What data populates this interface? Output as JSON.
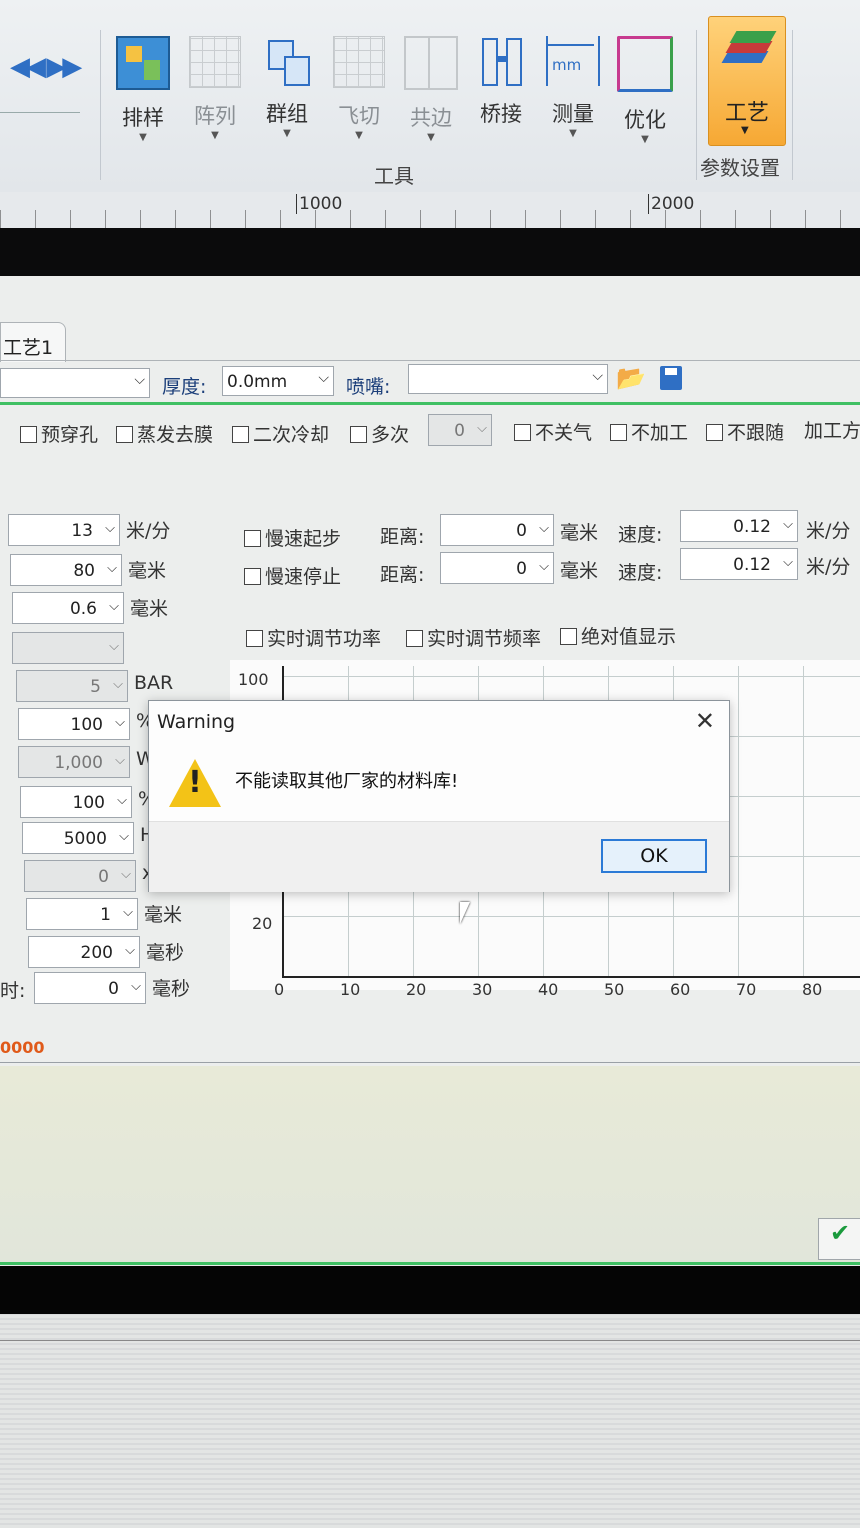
{
  "ribbon": {
    "tools": [
      {
        "label": "排样",
        "icon": "nesting-icon"
      },
      {
        "label": "阵列",
        "icon": "array-icon"
      },
      {
        "label": "群组",
        "icon": "group-icon"
      },
      {
        "label": "飞切",
        "icon": "fly-cut-icon"
      },
      {
        "label": "共边",
        "icon": "common-edge-icon"
      },
      {
        "label": "桥接",
        "icon": "bridge-icon"
      },
      {
        "label": "测量",
        "icon": "measure-icon"
      },
      {
        "label": "优化",
        "icon": "optimize-icon"
      }
    ],
    "group_label": "工具",
    "craft_label": "工艺",
    "param_group_label": "参数设置",
    "measure_unit": "mm"
  },
  "ruler": {
    "marks": [
      "1000",
      "2000"
    ]
  },
  "panel": {
    "tab_label": "工艺1",
    "thickness_label": "厚度:",
    "thickness_value": "0.0mm",
    "nozzle_label": "喷嘴:",
    "nozzle_value": "",
    "options": [
      "预穿孔",
      "蒸发去膜",
      "二次冷却",
      "多次"
    ],
    "multi_count": "0",
    "options_right": [
      "不关气",
      "不加工",
      "不跟随",
      "加工方"
    ],
    "left_params": [
      {
        "value": "13",
        "unit": "米/分"
      },
      {
        "value": "80",
        "unit": "毫米"
      },
      {
        "value": "0.6",
        "unit": "毫米"
      },
      {
        "value": "",
        "unit": ""
      },
      {
        "value": "5",
        "unit": "BAR"
      },
      {
        "value": "100",
        "unit": "%"
      },
      {
        "value": "1,000",
        "unit": "W"
      },
      {
        "value": "100",
        "unit": "%"
      },
      {
        "value": "5000",
        "unit": "H"
      },
      {
        "value": "0",
        "unit": "x"
      },
      {
        "value": "1",
        "unit": "毫米"
      },
      {
        "value": "200",
        "unit": "毫秒"
      },
      {
        "value": "0",
        "unit": "毫秒",
        "label": "时:"
      }
    ],
    "slow_start": {
      "label": "慢速起步",
      "dist_label": "距离:",
      "dist_value": "0",
      "dist_unit": "毫米",
      "speed_label": "速度:",
      "speed_value": "0.12",
      "speed_unit": "米/分"
    },
    "slow_stop": {
      "label": "慢速停止",
      "dist_label": "距离:",
      "dist_value": "0",
      "dist_unit": "毫米",
      "speed_label": "速度:",
      "speed_value": "0.12",
      "speed_unit": "米/分"
    },
    "graph_options": [
      "实时调节功率",
      "实时调节频率",
      "绝对值显示"
    ],
    "graph": {
      "y_ticks": [
        "100",
        "20"
      ],
      "x_ticks": [
        "0",
        "10",
        "20",
        "30",
        "40",
        "50",
        "60",
        "70",
        "80"
      ]
    },
    "status_number": "0000"
  },
  "dialog": {
    "title": "Warning",
    "close_glyph": "✕",
    "message": "不能读取其他厂家的材料库!",
    "ok_label": "OK",
    "icon_glyph": "!"
  },
  "colors": {
    "accent_green": "#40c064",
    "dialog_button_border": "#2b7ad6",
    "warning_yellow": "#f3c317",
    "status_orange": "#e05a1a"
  }
}
